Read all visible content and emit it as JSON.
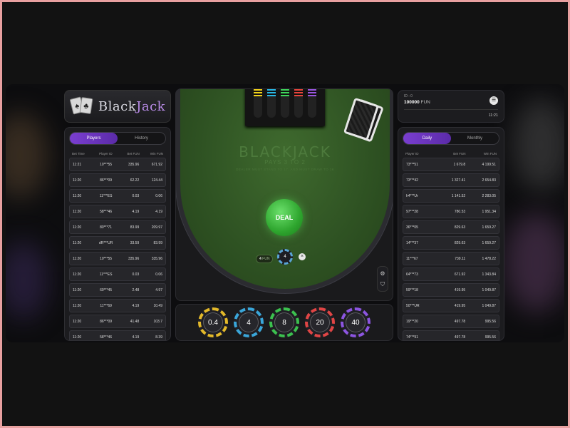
{
  "logo": {
    "text_black": "Black",
    "text_jack": "Jack",
    "card1": "♠",
    "card2": "♣"
  },
  "players_panel": {
    "tabs": [
      {
        "label": "Players",
        "active": true
      },
      {
        "label": "History",
        "active": false
      }
    ],
    "columns": [
      "Bet Time",
      "Player ID",
      "Bet FUN",
      "Win FUN"
    ],
    "rows": [
      [
        "11:21",
        "10***55",
        "335.96",
        "671.92"
      ],
      [
        "11:20",
        "86***09",
        "62.22",
        "124.44"
      ],
      [
        "11:20",
        "11***ES",
        "0.03",
        "0.06"
      ],
      [
        "11:20",
        "58***46",
        "4.19",
        "4.19"
      ],
      [
        "11:20",
        "80***71",
        "83.99",
        "209.97"
      ],
      [
        "11:20",
        "dR***UR",
        "33.59",
        "83.99"
      ],
      [
        "11:20",
        "10***55",
        "335.96",
        "335.96"
      ],
      [
        "11:20",
        "11***ES",
        "0.03",
        "0.06"
      ],
      [
        "11:20",
        "69***45",
        "2.48",
        "4.97"
      ],
      [
        "11:20",
        "11***69",
        "4.19",
        "10.49"
      ],
      [
        "11:20",
        "86***09",
        "41.48",
        "103.7"
      ],
      [
        "11:20",
        "58***46",
        "4.19",
        "8.39"
      ]
    ]
  },
  "account": {
    "id_label": "ID : 0",
    "balance": "100000",
    "currency": "FUN",
    "menu_icon": "☰",
    "time": "11:21"
  },
  "leaderboard": {
    "tabs": [
      {
        "label": "Daily",
        "active": true
      },
      {
        "label": "Monthly",
        "active": false
      }
    ],
    "columns": [
      "Player ID",
      "Bet FUN",
      "Win FUN"
    ],
    "rows": [
      [
        "73***51",
        "1 679.8",
        "4 199.51"
      ],
      [
        "73***42",
        "1 327.41",
        "2 654.83"
      ],
      [
        "h4***Ur",
        "1 141.52",
        "2 283.05"
      ],
      [
        "97***28",
        "780.53",
        "1 951.34"
      ],
      [
        "36***05",
        "829.63",
        "1 659.27"
      ],
      [
        "14***37",
        "829.63",
        "1 659.27"
      ],
      [
        "11***67",
        "739.11",
        "1 478.22"
      ],
      [
        "64***73",
        "671.92",
        "1 343.84"
      ],
      [
        "59***18",
        "419.95",
        "1 049.87"
      ],
      [
        "50***UR",
        "419.95",
        "1 049.87"
      ],
      [
        "19***20",
        "497.78",
        "995.56"
      ],
      [
        "74***91",
        "497.78",
        "995.56"
      ]
    ]
  },
  "table": {
    "title": "BLACKJACK",
    "subtitle": "PAYS 3 TO 2",
    "rule": "DEALER MUST STAND TO 17, AND MUST DRAW TO 16",
    "deal_label": "DEAL",
    "bet_amount": "4",
    "bet_currency": "FUN",
    "bet_chip_value": "4",
    "clear_icon": "×",
    "settings_icon": "⚙",
    "shield_icon": "⛉",
    "shoe_colors": [
      "#f2d21a",
      "#29b8e6",
      "#3ed45a",
      "#e8453c",
      "#9a56e0"
    ]
  },
  "chips": [
    {
      "value": "0.4",
      "color": "#e3b92a"
    },
    {
      "value": "4",
      "color": "#3aa6d9"
    },
    {
      "value": "8",
      "color": "#3cc04f"
    },
    {
      "value": "20",
      "color": "#e04545"
    },
    {
      "value": "40",
      "color": "#8c55e0"
    }
  ]
}
